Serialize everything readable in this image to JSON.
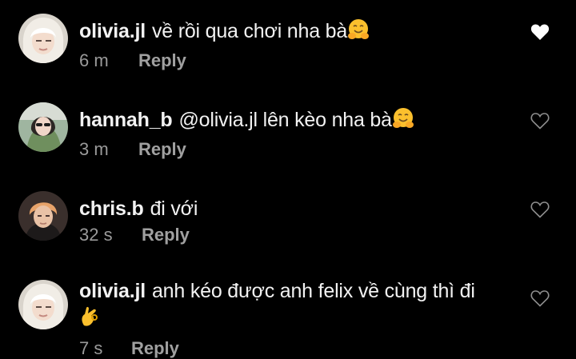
{
  "comments": [
    {
      "username": "olivia.jl",
      "text": "về rồi qua chơi nha bà",
      "emoji": "hugging-face",
      "time": "6 m",
      "reply": "Reply",
      "liked": true
    },
    {
      "username": "hannah_b",
      "text": "@olivia.jl lên kèo nha bà",
      "emoji": "hugging-face",
      "time": "3 m",
      "reply": "Reply",
      "liked": false
    },
    {
      "username": "chris.b",
      "text": "đi với",
      "emoji": "",
      "time": "32 s",
      "reply": "Reply",
      "liked": false
    },
    {
      "username": "olivia.jl",
      "text": "anh kéo được anh felix về cùng thì đi",
      "emoji": "ok-hand",
      "time": "7 s",
      "reply": "Reply",
      "liked": false
    }
  ],
  "colors": {
    "background": "#000000",
    "text": "#f2f2f2",
    "meta": "#9a9a9a",
    "heart_filled": "#ffffff",
    "heart_outline": "#8e8e8e"
  }
}
